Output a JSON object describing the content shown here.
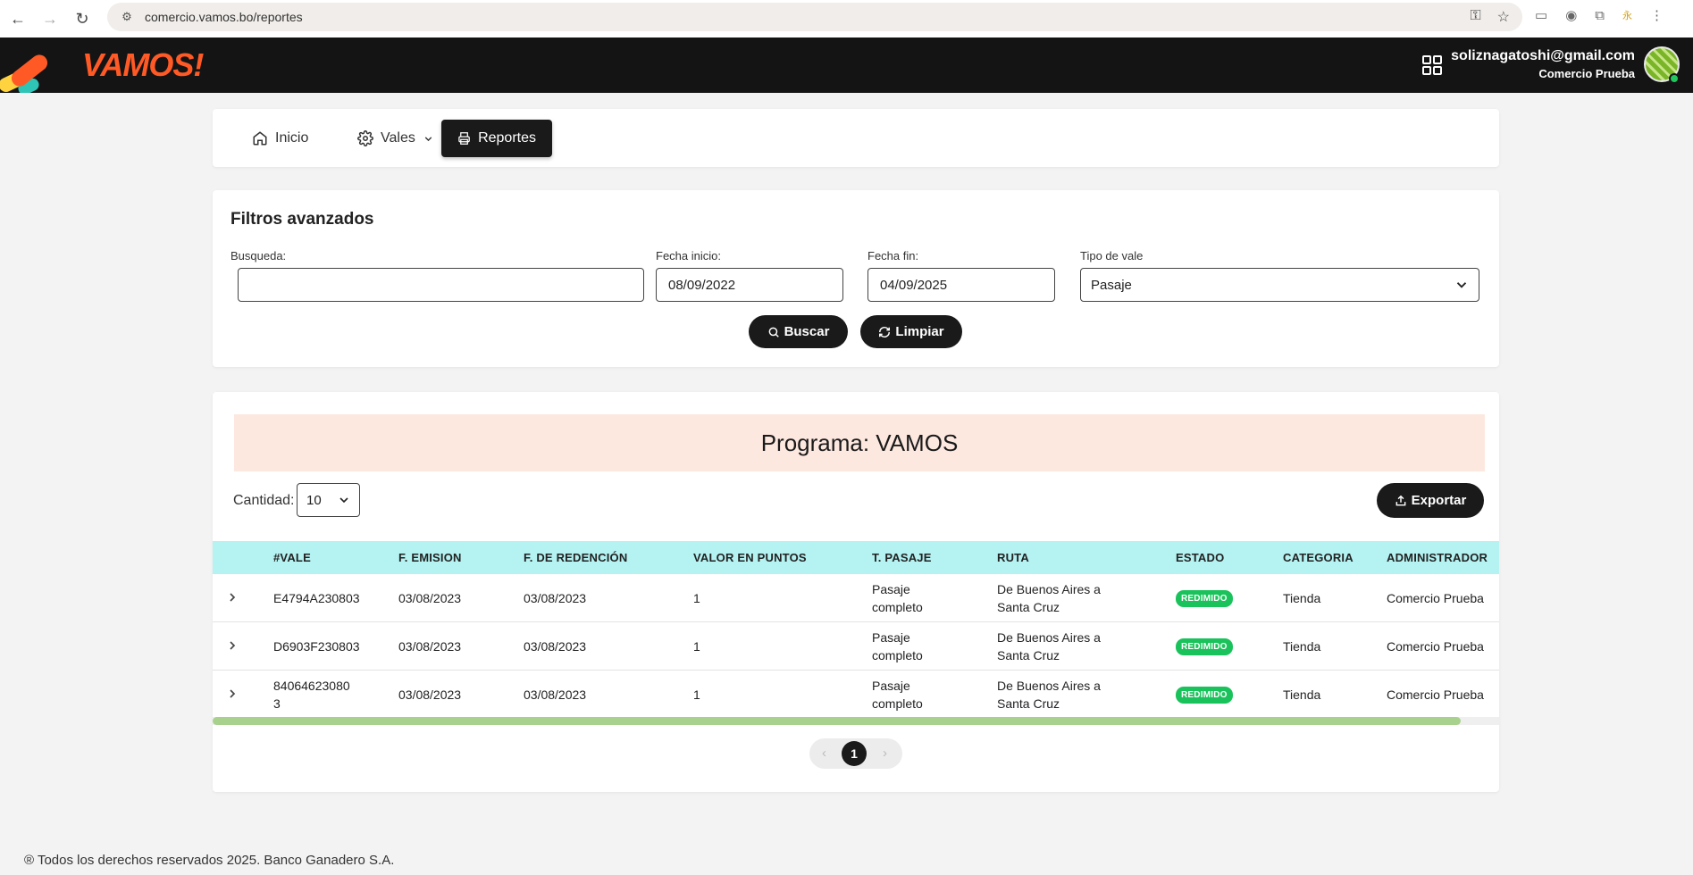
{
  "browser": {
    "url": "comercio.vamos.bo/reportes"
  },
  "header": {
    "logo": "VAMOS!",
    "user_email": "soliznagatoshi@gmail.com",
    "user_company": "Comercio Prueba"
  },
  "nav": {
    "items": [
      {
        "label": "Inicio",
        "icon": "home-icon"
      },
      {
        "label": "Vales",
        "icon": "gear-icon"
      },
      {
        "label": "Reportes",
        "icon": "printer-icon",
        "active": true
      }
    ]
  },
  "filters": {
    "title": "Filtros avanzados",
    "search_label": "Busqueda:",
    "search_value": "",
    "start_label": "Fecha inicio:",
    "start_value": "08/09/2022",
    "end_label": "Fecha fin:",
    "end_value": "04/09/2025",
    "type_label": "Tipo de vale",
    "type_value": "Pasaje",
    "search_button": "Buscar",
    "clear_button": "Limpiar"
  },
  "results": {
    "program_banner": "Programa: VAMOS",
    "quantity_label": "Cantidad:",
    "quantity_value": "10",
    "export_button": "Exportar",
    "columns": [
      "#VALE",
      "F. EMISION",
      "F. DE REDENCIÓN",
      "VALOR EN PUNTOS",
      "T. PASAJE",
      "RUTA",
      "ESTADO",
      "CATEGORIA",
      "ADMINISTRADOR"
    ],
    "rows": [
      {
        "vale": "E4794A230803",
        "emision": "03/08/2023",
        "redencion": "03/08/2023",
        "puntos": "1",
        "pasaje_1": "Pasaje",
        "pasaje_2": "completo",
        "ruta_1": "De Buenos Aires a",
        "ruta_2": "Santa Cruz",
        "estado": "REDIMIDO",
        "categoria": "Tienda",
        "admin": "Comercio Prueba"
      },
      {
        "vale": "D6903F230803",
        "emision": "03/08/2023",
        "redencion": "03/08/2023",
        "puntos": "1",
        "pasaje_1": "Pasaje",
        "pasaje_2": "completo",
        "ruta_1": "De Buenos Aires a",
        "ruta_2": "Santa Cruz",
        "estado": "REDIMIDO",
        "categoria": "Tienda",
        "admin": "Comercio Prueba"
      },
      {
        "vale": "84064623080",
        "vale_2": "3",
        "emision": "03/08/2023",
        "redencion": "03/08/2023",
        "puntos": "1",
        "pasaje_1": "Pasaje",
        "pasaje_2": "completo",
        "ruta_1": "De Buenos Aires a",
        "ruta_2": "Santa Cruz",
        "estado": "REDIMIDO",
        "categoria": "Tienda",
        "admin": "Comercio Prueba"
      }
    ],
    "pagination": {
      "prev": "‹",
      "current": "1",
      "next": "›"
    }
  },
  "footer": {
    "text": "® Todos los derechos reservados 2025. Banco Ganadero S.A."
  },
  "colors": {
    "brand_orange": "#ff5a26",
    "header_bg": "#141414",
    "table_header_bg": "#b5f2f2",
    "banner_bg": "#fde8e0",
    "status_green": "#19c25a"
  }
}
